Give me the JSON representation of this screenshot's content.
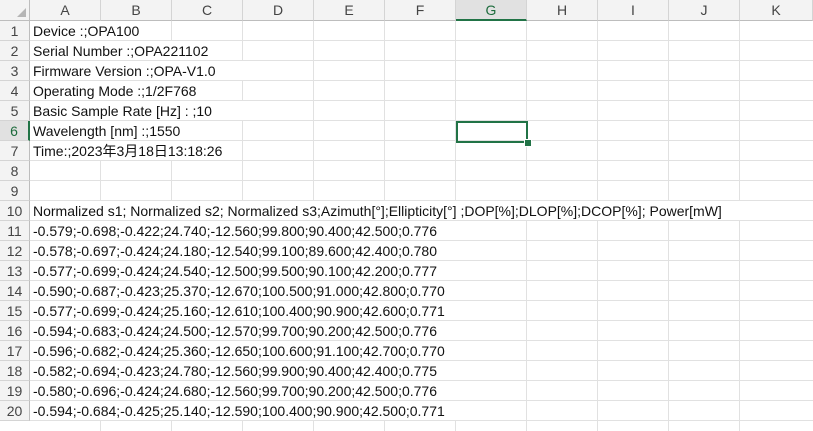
{
  "columns": [
    "A",
    "B",
    "C",
    "D",
    "E",
    "F",
    "G",
    "H",
    "I",
    "J",
    "K"
  ],
  "rows": [
    "1",
    "2",
    "3",
    "4",
    "5",
    "6",
    "7",
    "8",
    "9",
    "10",
    "11",
    "12",
    "13",
    "14",
    "15",
    "16",
    "17",
    "18",
    "19",
    "20"
  ],
  "selected": {
    "column": "G",
    "row": "6"
  },
  "colors": {
    "accent": "#217346",
    "grid": "#e1e1e1",
    "header_bg": "#f3f3f3"
  },
  "cells": [
    "Device :;OPA100",
    "Serial Number :;OPA221102",
    "Firmware Version :;OPA-V1.0",
    "Operating Mode :;1/2F768",
    "Basic Sample Rate [Hz] : ;10",
    "Wavelength [nm] :;1550",
    "Time:;2023年3月18日13:18:26",
    "",
    "",
    " Normalized s1; Normalized s2; Normalized s3;Azimuth[°];Ellipticity[°] ;DOP[%];DLOP[%];DCOP[%]; Power[mW]",
    "-0.579;-0.698;-0.422;24.740;-12.560;99.800;90.400;42.500;0.776",
    "-0.578;-0.697;-0.424;24.180;-12.540;99.100;89.600;42.400;0.780",
    "-0.577;-0.699;-0.424;24.540;-12.500;99.500;90.100;42.200;0.777",
    "-0.590;-0.687;-0.423;25.370;-12.670;100.500;91.000;42.800;0.770",
    "-0.577;-0.699;-0.424;25.160;-12.610;100.400;90.900;42.600;0.771",
    "-0.594;-0.683;-0.424;24.500;-12.570;99.700;90.200;42.500;0.776",
    "-0.596;-0.682;-0.424;25.360;-12.650;100.600;91.100;42.700;0.770",
    "-0.582;-0.694;-0.423;24.780;-12.560;99.900;90.400;42.400;0.775",
    "-0.580;-0.696;-0.424;24.680;-12.560;99.700;90.200;42.500;0.776",
    "-0.594;-0.684;-0.425;25.140;-12.590;100.400;90.900;42.500;0.771"
  ]
}
